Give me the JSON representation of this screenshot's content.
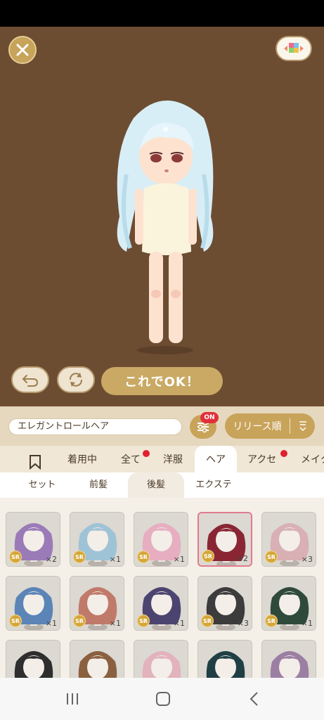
{
  "stage": {
    "close_icon": "close-icon",
    "palette_icon": "palette-icon",
    "undo_icon": "undo-icon",
    "rotate_icon": "rotate-icon",
    "ok_label": "これでOK！"
  },
  "filter": {
    "name_value": "エレガントロールヘア",
    "filter_badge": "ON",
    "sort_label": "リリース順"
  },
  "tabs": [
    {
      "label": "着用中"
    },
    {
      "label": "全て"
    },
    {
      "label": "洋服"
    },
    {
      "label": "ヘア"
    },
    {
      "label": "アクセ"
    },
    {
      "label": "メイク"
    }
  ],
  "subtabs": [
    {
      "label": "セット"
    },
    {
      "label": "前髪"
    },
    {
      "label": "後髪"
    },
    {
      "label": "エクステ"
    }
  ],
  "items": [
    {
      "rarity": "SR",
      "count": "×2",
      "hair": "#9a7bb8"
    },
    {
      "rarity": "SR",
      "count": "×1",
      "hair": "#9fc3d6"
    },
    {
      "rarity": "SR",
      "count": "×1",
      "hair": "#e6aec0"
    },
    {
      "rarity": "SR",
      "count": "×2",
      "hair": "#8a2634"
    },
    {
      "rarity": "SR",
      "count": "×3",
      "hair": "#d9b0b4"
    },
    {
      "rarity": "SR",
      "count": "×1",
      "hair": "#5b84b7"
    },
    {
      "rarity": "SR",
      "count": "×1",
      "hair": "#c07a6a"
    },
    {
      "rarity": "SR",
      "count": "×1",
      "hair": "#4c4470"
    },
    {
      "rarity": "SR",
      "count": "×3",
      "hair": "#3c3c3c"
    },
    {
      "rarity": "SR",
      "count": "×1",
      "hair": "#2f4a3a"
    },
    {
      "rarity": "",
      "count": "",
      "hair": "#2e2e2e"
    },
    {
      "rarity": "",
      "count": "",
      "hair": "#8a6040"
    },
    {
      "rarity": "",
      "count": "",
      "hair": "#e2b2bd"
    },
    {
      "rarity": "",
      "count": "",
      "hair": "#1f3f45"
    },
    {
      "rarity": "",
      "count": "",
      "hair": "#9b7fa3"
    }
  ],
  "colors": {
    "stage_bg": "#6d4d32",
    "accent_gold": "#c8a35a",
    "selected_border": "#e07a8e",
    "badge_red": "#e0303a"
  }
}
